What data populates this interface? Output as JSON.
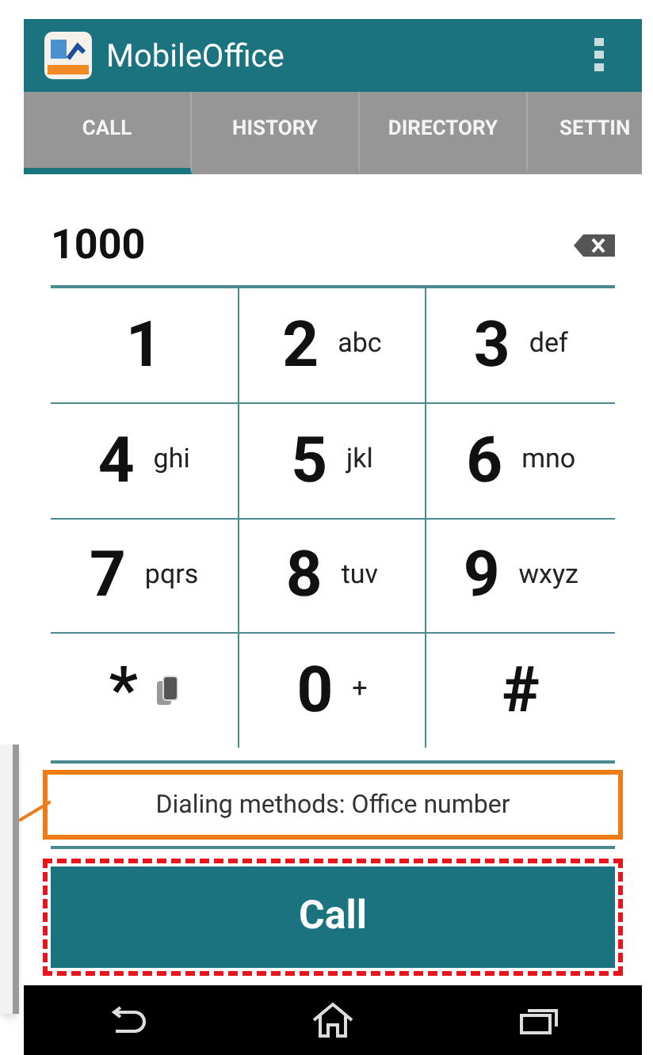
{
  "app_bar": {
    "title": "MobileOffice"
  },
  "tabs": [
    {
      "label": "CALL",
      "selected": true
    },
    {
      "label": "HISTORY",
      "selected": false
    },
    {
      "label": "DIRECTORY",
      "selected": false
    },
    {
      "label": "SETTIN",
      "selected": false
    }
  ],
  "dial_field": {
    "value": "1000"
  },
  "keys": [
    {
      "kind": "text",
      "main": "1"
    },
    {
      "kind": "text",
      "main": "2",
      "sub": "abc"
    },
    {
      "kind": "text",
      "main": "3",
      "sub": "def"
    },
    {
      "kind": "text",
      "main": "4",
      "sub": "ghi"
    },
    {
      "kind": "text",
      "main": "5",
      "sub": "jkl"
    },
    {
      "kind": "text",
      "main": "6",
      "sub": "mno"
    },
    {
      "kind": "text",
      "main": "7",
      "sub": "pqrs"
    },
    {
      "kind": "text",
      "main": "8",
      "sub": "tuv"
    },
    {
      "kind": "text",
      "main": "9",
      "sub": "wxyz"
    },
    {
      "kind": "icon",
      "main": "*"
    },
    {
      "kind": "text",
      "main": "0",
      "sub": "+"
    },
    {
      "kind": "text",
      "main": "#"
    }
  ],
  "dialing_method": {
    "text": "Dialing methods: Office number"
  },
  "call_button": {
    "label": "Call"
  }
}
